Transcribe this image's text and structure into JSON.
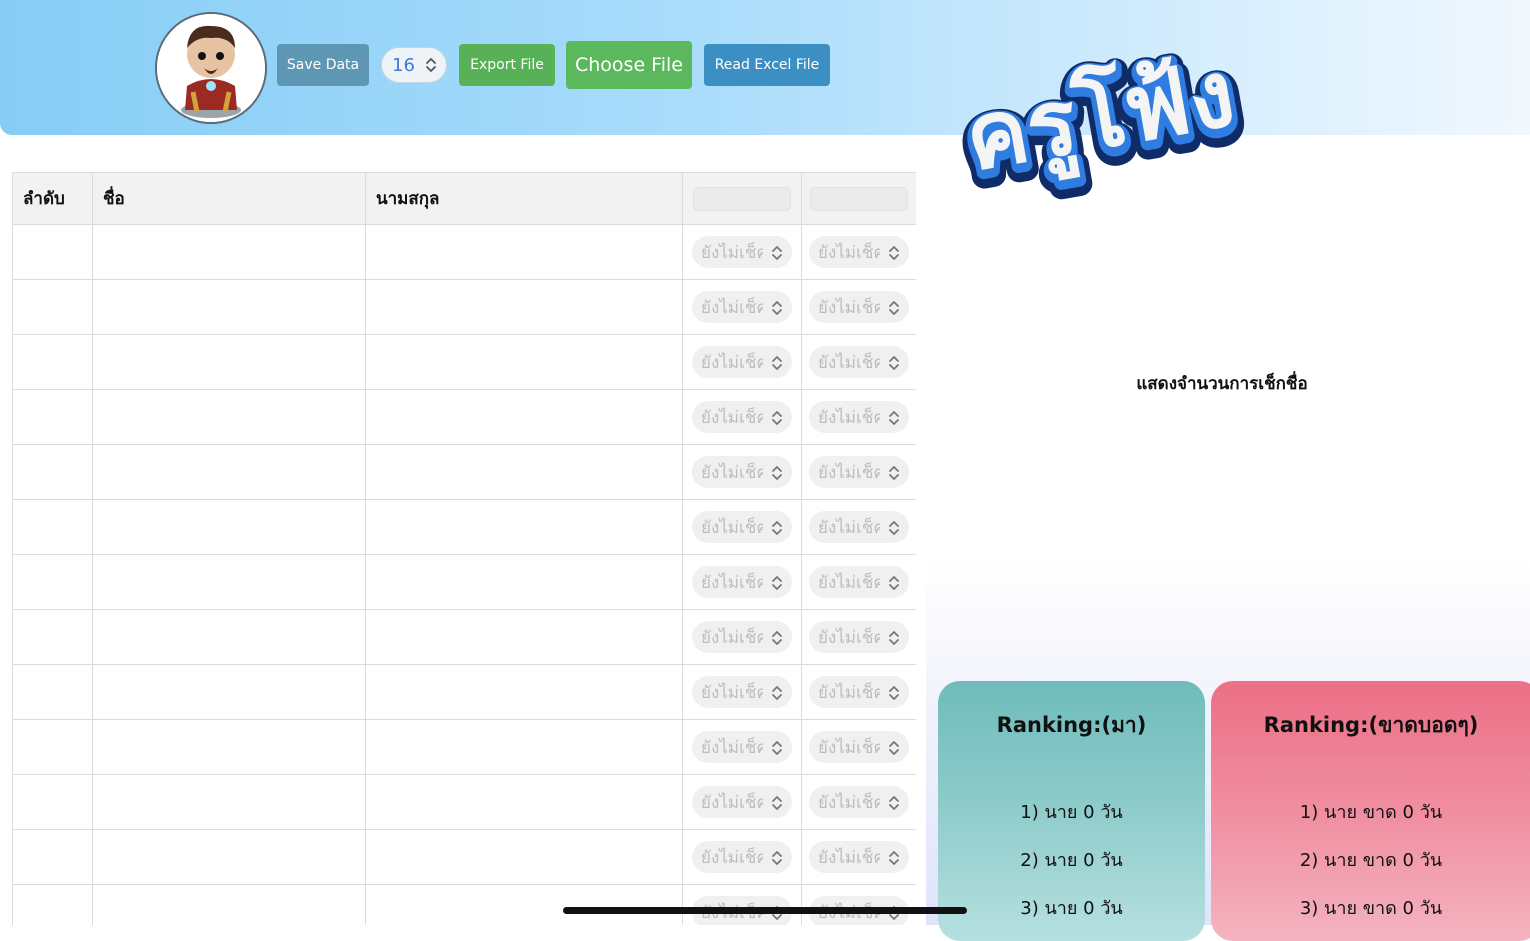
{
  "toolbar": {
    "save_label": "Save Data",
    "stepper_value": "16",
    "export_label": "Export File",
    "choose_label": "Choose File",
    "read_label": "Read Excel File"
  },
  "logo_text": "ครูโฟ้ง",
  "table": {
    "headers": [
      "ลำดับ",
      "ชื่อ",
      "นามสกุล"
    ],
    "status_placeholder": "ยังไม่เช็ค",
    "row_count": 13
  },
  "count_label": "แสดงจำนวนการเช็กชื่อ",
  "ranking_come": {
    "title": "Ranking:(มา)",
    "items": [
      "1) นาย 0 วัน",
      "2) นาย 0 วัน",
      "3) นาย 0 วัน"
    ]
  },
  "ranking_absent": {
    "title": "Ranking:(ขาดบอดๆ)",
    "items": [
      "1) นาย ขาด 0 วัน",
      "2) นาย ขาด 0 วัน",
      "3) นาย ขาด 0 วัน"
    ]
  },
  "colors": {
    "header_start": "#86cdf5",
    "save": "#5e97b4",
    "export": "#58b156",
    "choose": "#5cb85c",
    "read": "#3c8fc3",
    "rank_come": "#6fbcbc",
    "rank_absent": "#ec6f86"
  }
}
